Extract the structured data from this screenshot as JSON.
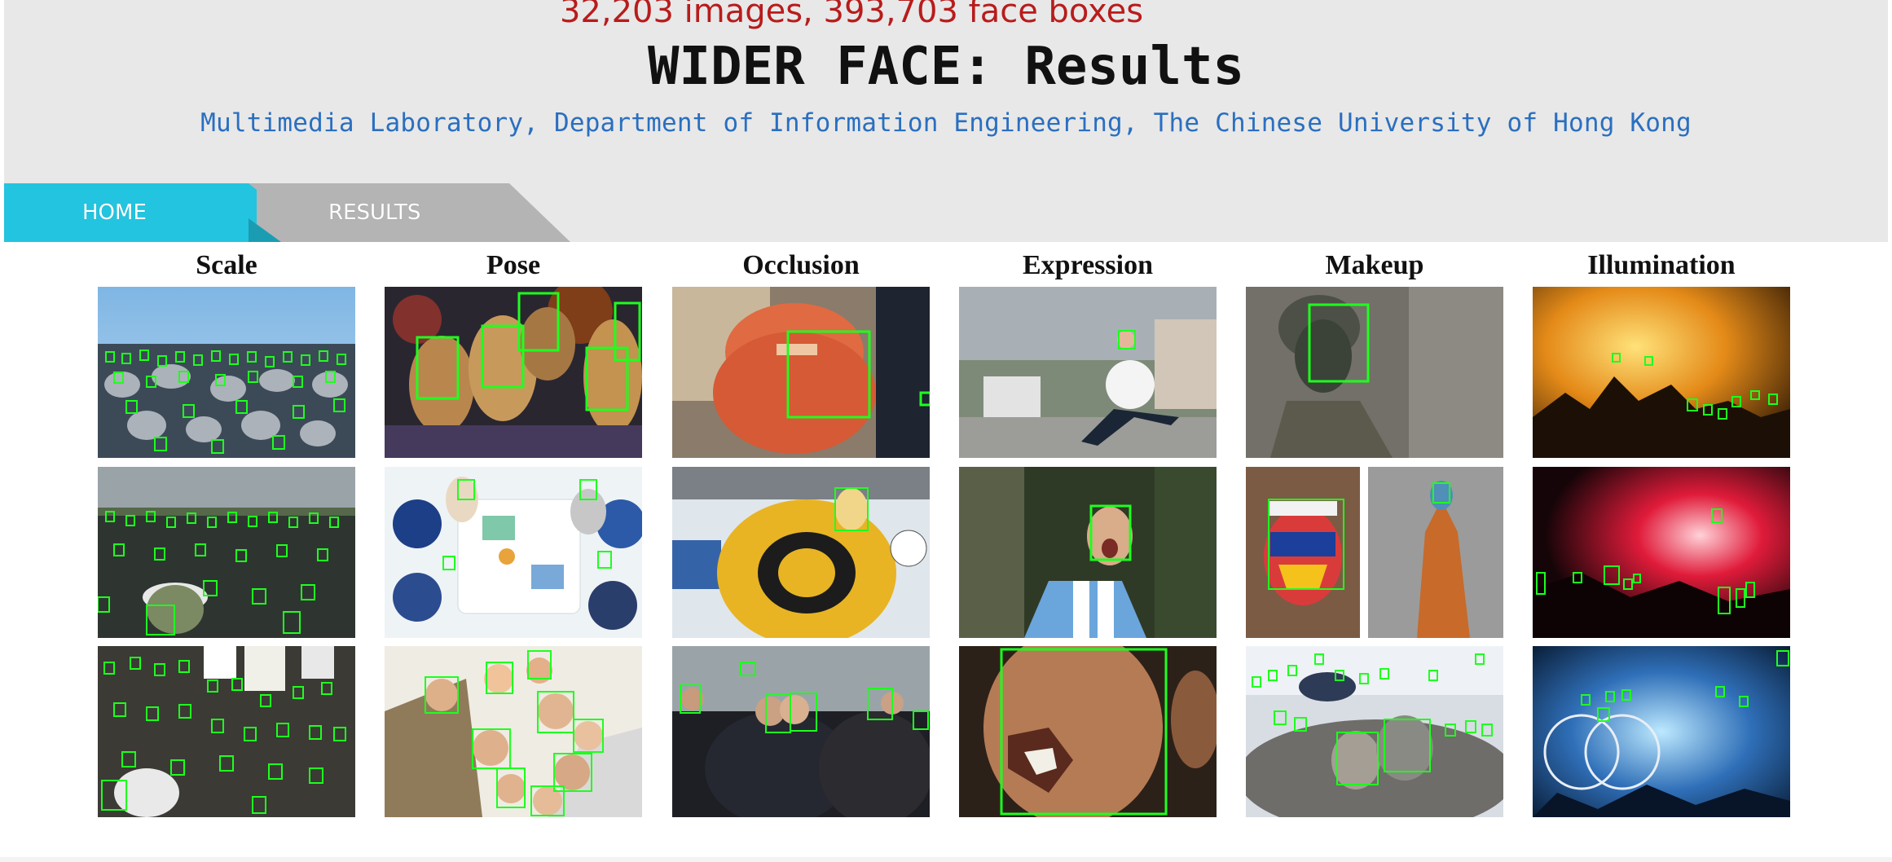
{
  "header": {
    "counts": "32,203 images, 393,703 face boxes",
    "title": "WIDER FACE: Results",
    "subtitle": "Multimedia Laboratory, Department of Information Engineering, The Chinese University of Hong Kong"
  },
  "nav": {
    "tabs": [
      {
        "label": "HOME",
        "active": true
      },
      {
        "label": "RESULTS",
        "active": false
      }
    ]
  },
  "grid": {
    "columns": [
      {
        "label": "Scale",
        "images": [
          "crowd-of-band-members",
          "street-crowd-with-cap",
          "protest-crowd-signs"
        ]
      },
      {
        "label": "Pose",
        "images": [
          "cheerleaders-smiling",
          "overhead-desk-meeting",
          "group-selfie-from-below"
        ]
      },
      {
        "label": "Occlusion",
        "images": [
          "face-covered-with-scarf",
          "hockey-goalie-mask",
          "crowd-embracing"
        ]
      },
      {
        "label": "Expression",
        "images": [
          "woman-jumping",
          "fan-shouting-argentina-shirt",
          "man-shouting-closeup"
        ]
      },
      {
        "label": "Makeup",
        "images": [
          "soldier-face-paint",
          "painted-face-and-body-paint",
          "group-with-face-paint"
        ]
      },
      {
        "label": "Illumination",
        "images": [
          "fire-crowd-silhouettes",
          "red-smoke-concert",
          "blue-light-stage"
        ]
      }
    ],
    "box_color": "#1eff1e"
  },
  "colors": {
    "header_bg": "#e8e8e8",
    "counts": "#b81c1c",
    "subtitle": "#2a6fc0",
    "tab_home": "#23c4df",
    "tab_results": "#b4b4b4"
  }
}
